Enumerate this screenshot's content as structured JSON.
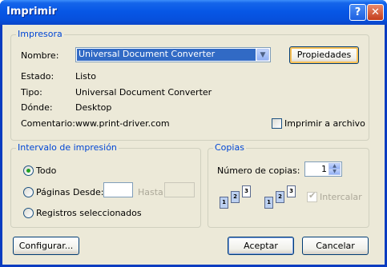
{
  "window": {
    "title": "Imprimir",
    "help_glyph": "?",
    "close_glyph": "✕"
  },
  "printer": {
    "legend": "Impresora",
    "name_label": "Nombre:",
    "name_value": "Universal Document Converter",
    "properties_button": "Propiedades",
    "status_label": "Estado:",
    "status_value": "Listo",
    "type_label": "Tipo:",
    "type_value": "Universal Document Converter",
    "where_label": "Dónde:",
    "where_value": "Desktop",
    "comment_label": "Comentario:",
    "comment_value": "www.print-driver.com",
    "print_to_file_label": "Imprimir a archivo",
    "print_to_file_checked": false
  },
  "range": {
    "legend": "Intervalo de impresión",
    "all_label": "Todo",
    "pages_label": "Páginas",
    "from_label": "Desde:",
    "from_value": "",
    "to_label": "Hasta:",
    "to_value": "",
    "selection_label": "Registros seleccionados",
    "selected": "all"
  },
  "copies": {
    "legend": "Copias",
    "count_label": "Número de copias:",
    "count_value": "1",
    "collate_label": "Intercalar",
    "collate_checked": true,
    "collate_disabled": true,
    "page_digits": [
      "1",
      "2",
      "3"
    ]
  },
  "footer": {
    "setup_button": "Configurar...",
    "ok_button": "Aceptar",
    "cancel_button": "Cancelar"
  },
  "colors": {
    "title_bar": "#0757e6",
    "accent": "#0046d5",
    "face": "#ece9d8",
    "selection": "#316ac5"
  }
}
